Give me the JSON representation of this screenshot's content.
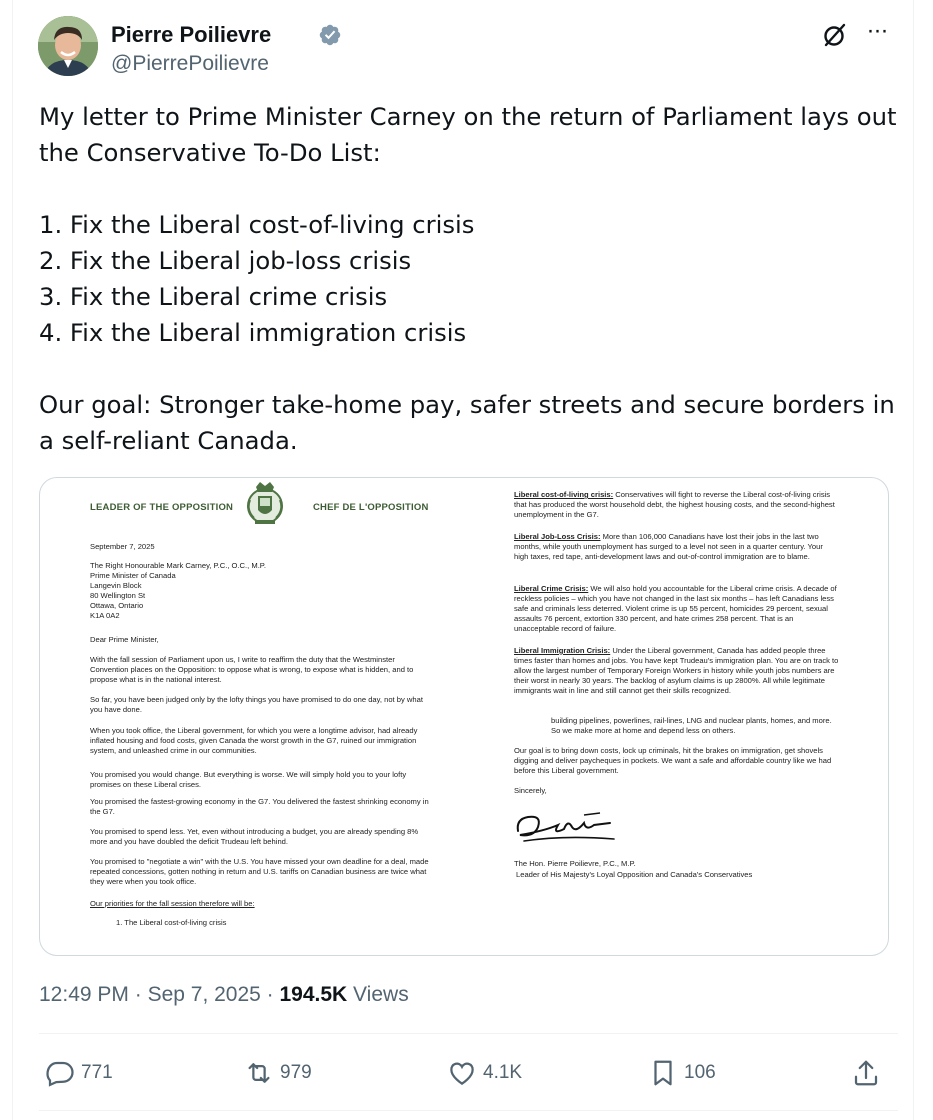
{
  "author": {
    "name": "Pierre Poilievre",
    "handle": "@PierrePoilievre"
  },
  "tweet": {
    "text": "My letter to Prime Minister Carney on the return of Parliament lays out the Conservative To-Do List:\n\n1. Fix the Liberal cost-of-living crisis\n2. Fix the Liberal job-loss crisis\n3. Fix the Liberal crime crisis\n4. Fix the Liberal immigration crisis\n\nOur goal: Stronger take-home pay, safer streets and secure borders in a self-reliant Canada."
  },
  "letter": {
    "header_left": "LEADER OF THE OPPOSITION",
    "header_right": "CHEF DE L'OPPOSITION",
    "date": "September 7, 2025",
    "address": "The Right Honourable Mark Carney, P.C., O.C., M.P.\nPrime Minister of Canada\nLangevin Block\n80 Wellington St\nOttawa, Ontario\nK1A 0A2",
    "salutation": "Dear Prime Minister,",
    "p1": "With the fall session of Parliament upon us, I write to reaffirm the duty that the Westminster Convention places on the Opposition: to oppose what is wrong, to expose what is hidden, and to propose what is in the national interest.",
    "p2": "So far, you have been judged only by the lofty things you have promised to do one day, not by what you have done.",
    "p3": "When you took office, the Liberal government, for which you were a longtime advisor, had already inflated housing and food costs, given Canada the worst growth in the G7, ruined our immigration system, and unleashed crime in our communities.",
    "p4": "You promised you would change. But everything is worse. We will simply hold you to your lofty promises on these Liberal crises.",
    "p5": "You promised the fastest-growing economy in the G7. You delivered the fastest shrinking economy in the G7.",
    "p6": "You promised to spend less. Yet, even without introducing a budget, you are already spending 8% more and you have doubled the deficit Trudeau left behind.",
    "p7": "You promised to \"negotiate a win\" with the U.S. You have missed your own deadline for a deal, made repeated concessions, gotten nothing in return and U.S. tariffs on Canadian business are twice what they were when you took office.",
    "priorities_heading": "Our priorities for the fall session therefore will be:",
    "priority_1": "1.   The Liberal cost-of-living crisis",
    "r1_head": "Liberal cost-of-living crisis:",
    "r1_body": " Conservatives will fight to reverse the Liberal cost-of-living crisis that has produced the worst household debt, the highest housing costs, and the second-highest unemployment in the G7.",
    "r2_head": "Liberal Job-Loss Crisis:",
    "r2_body": " More than 106,000 Canadians have lost their jobs in the last two months, while youth unemployment has surged to a level not seen in a quarter century. Your high taxes, red tape, anti-development laws and out-of-control immigration are to blame.",
    "r3_head": "Liberal Crime Crisis:",
    "r3_body": " We will also hold you accountable for the Liberal crime crisis. A decade of reckless policies – which you have not changed in the last six months – has left Canadians less safe and criminals less deterred. Violent crime is up 55 percent, homicides 29 percent, sexual assaults 76 percent, extortion 330 percent, and hate crimes 258 percent. That is an unacceptable record of failure.",
    "r4_head": "Liberal Immigration Crisis:",
    "r4_body": " Under the Liberal government, Canada has added people three times faster than homes and jobs. You have kept Trudeau's immigration plan. You are on track to allow the largest number of Temporary Foreign Workers in history while youth jobs numbers are their worst in nearly 30 years. The backlog of asylum claims is up 2800%. All while legitimate immigrants wait in line and still cannot get their skills recognized.",
    "r5": "building pipelines, powerlines, rail-lines, LNG and nuclear plants, homes, and more. So we make more at home and depend less on others.",
    "r6": "Our goal is to bring down costs, lock up criminals, hit the brakes on immigration, get shovels digging and deliver paycheques in pockets. We want a safe and affordable country like we had before this Liberal government.",
    "closing": "Sincerely,",
    "sign_name": "The Hon. Pierre Poilievre, P.C., M.P.",
    "sign_title": "Leader of His Majesty's Loyal Opposition and Canada's Conservatives"
  },
  "meta": {
    "time": "12:49 PM",
    "sep1": " · ",
    "date": "Sep 7, 2025",
    "sep2": " · ",
    "views": "194.5K",
    "views_label": " Views"
  },
  "actions": {
    "replies": "771",
    "reposts": "979",
    "likes": "4.1K",
    "bookmarks": "106"
  },
  "colors": {
    "text": "#0f1419",
    "secondary": "#536471",
    "verified": "#829aab",
    "border": "#cfd9de",
    "letterhead_green": "#3d5c34"
  }
}
